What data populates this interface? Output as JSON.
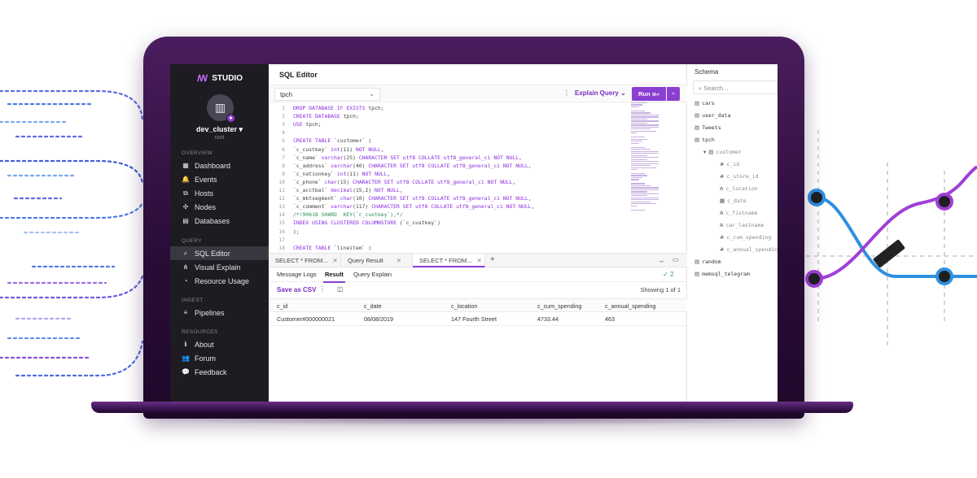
{
  "sidebar": {
    "logo": "STUDIO",
    "cluster_name": "dev_cluster",
    "cluster_user": "root",
    "sections": {
      "overview": "OVERVIEW",
      "query": "QUERY",
      "ingest": "INGEST",
      "resources": "RESOURCES"
    },
    "items": [
      {
        "label": "Dashboard",
        "icon": "dashboard-icon",
        "glyph": "▦"
      },
      {
        "label": "Events",
        "icon": "bell-icon",
        "glyph": "🔔"
      },
      {
        "label": "Hosts",
        "icon": "hosts-icon",
        "glyph": "⧉"
      },
      {
        "label": "Nodes",
        "icon": "nodes-icon",
        "glyph": "✣"
      },
      {
        "label": "Databases",
        "icon": "database-icon",
        "glyph": "▤"
      },
      {
        "label": "SQL Editor",
        "icon": "sql-editor-icon",
        "glyph": "⌕"
      },
      {
        "label": "Visual Explain",
        "icon": "tree-icon",
        "glyph": "⋔"
      },
      {
        "label": "Resource Usage",
        "icon": "gauge-icon",
        "glyph": "◔"
      },
      {
        "label": "Pipelines",
        "icon": "pipelines-icon",
        "glyph": "≡"
      },
      {
        "label": "About",
        "icon": "info-icon",
        "glyph": "ℹ"
      },
      {
        "label": "Forum",
        "icon": "people-icon",
        "glyph": "👥"
      },
      {
        "label": "Feedback",
        "icon": "chat-icon",
        "glyph": "💬"
      }
    ]
  },
  "main": {
    "title": "SQL Editor",
    "database": "tpch",
    "explain_label": "Explain Query",
    "run_label": "Run",
    "run_shortcut": "⌘↵",
    "code_lines": [
      "DROP DATABASE IF EXISTS tpch;",
      "CREATE DATABASE tpch;",
      "USE tpch;",
      "",
      "CREATE TABLE `customer` (",
      "`c_custkey` int(11) NOT NULL,",
      "`c_name` varchar(25) CHARACTER SET utf8 COLLATE utf8_general_ci NOT NULL,",
      "`c_address` varchar(40) CHARACTER SET utf8 COLLATE utf8_general_ci NOT NULL,",
      "`c_nationkey` int(11) NOT NULL,",
      "`c_phone` char(15) CHARACTER SET utf8 COLLATE utf8_general_ci NOT NULL,",
      "`c_acctbal` decimal(15,2) NOT NULL,",
      "`c_mktsegment` char(10) CHARACTER SET utf8 COLLATE utf8_general_ci NOT NULL,",
      "`c_comment` varchar(117) CHARACTER SET utf8 COLLATE utf8_general_ci NOT NULL,",
      "/*!90618 SHARD  KEY(`c_custkey`),*/",
      "INDEX USING CLUSTERED COLUMNSTORE (`c_custkey`)",
      ");",
      "",
      "CREATE TABLE `lineitem` ("
    ],
    "tabs": [
      {
        "label": "SELECT * FROM...",
        "active": false
      },
      {
        "label": "Query Result",
        "active": false
      },
      {
        "label": "SELECT * FROM...",
        "active": true
      }
    ],
    "add_tab": "+",
    "subtabs": [
      "Message Logs",
      "Result",
      "Query Explain"
    ],
    "check_count": "2",
    "save_csv": "Save as CSV",
    "showing": "Showing 1 of 1",
    "columns": [
      "c_id",
      "c_date",
      "c_location",
      "c_cum_spending",
      "c_annual_spending"
    ],
    "rows": [
      [
        "Customer#000000021",
        "08/08/2019",
        "147 Fourth Street",
        "4733.44",
        "463"
      ]
    ]
  },
  "schema": {
    "title": "Schema",
    "search_placeholder": "Search...",
    "items": [
      "cars",
      "user_data",
      "Tweets",
      "tpch"
    ],
    "table": "customer",
    "columns": [
      {
        "type": "#",
        "name": "c_id"
      },
      {
        "type": "#",
        "name": "c_store_id"
      },
      {
        "type": "A",
        "name": "c_location"
      },
      {
        "type": "▦",
        "name": "c_date"
      },
      {
        "type": "A",
        "name": "c_fistname"
      },
      {
        "type": "A",
        "name": "car_lastname"
      },
      {
        "type": "#",
        "name": "c_cum_spending"
      },
      {
        "type": "#",
        "name": "c_annual_spending"
      }
    ],
    "after": [
      "random",
      "memsql_telegram"
    ]
  },
  "colors": {
    "accent": "#8a3fd1",
    "sidebar_bg": "#1e1c22",
    "frame": "#2a0d38",
    "blue_line": "#2f8fe0"
  }
}
